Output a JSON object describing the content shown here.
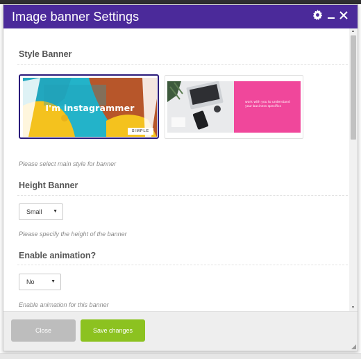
{
  "dialog": {
    "title": "Image banner Settings",
    "icons": [
      "gear-icon",
      "minimize-icon",
      "close-icon"
    ]
  },
  "sections": {
    "style": {
      "title": "Style Banner",
      "hint": "Please select main style for banner",
      "options": [
        {
          "name": "simple",
          "text": "I'm instagrammer",
          "tag": "SIMPLE",
          "selected": true
        },
        {
          "name": "split",
          "text": "work with you to understand your business specifics",
          "selected": false
        }
      ]
    },
    "height": {
      "title": "Height Banner",
      "value": "Small",
      "hint": "Please specify the height of the banner"
    },
    "animation": {
      "title": "Enable animation?",
      "value": "No",
      "hint": "Enable animation for this banner"
    }
  },
  "footer": {
    "close_label": "Close",
    "save_label": "Save changes"
  },
  "colors": {
    "titlebar": "#4b2a9a",
    "save_button": "#8cc220",
    "close_button": "#bdbdbd",
    "selected_border": "#2a1a7a",
    "banner_pink": "#f0479b"
  }
}
